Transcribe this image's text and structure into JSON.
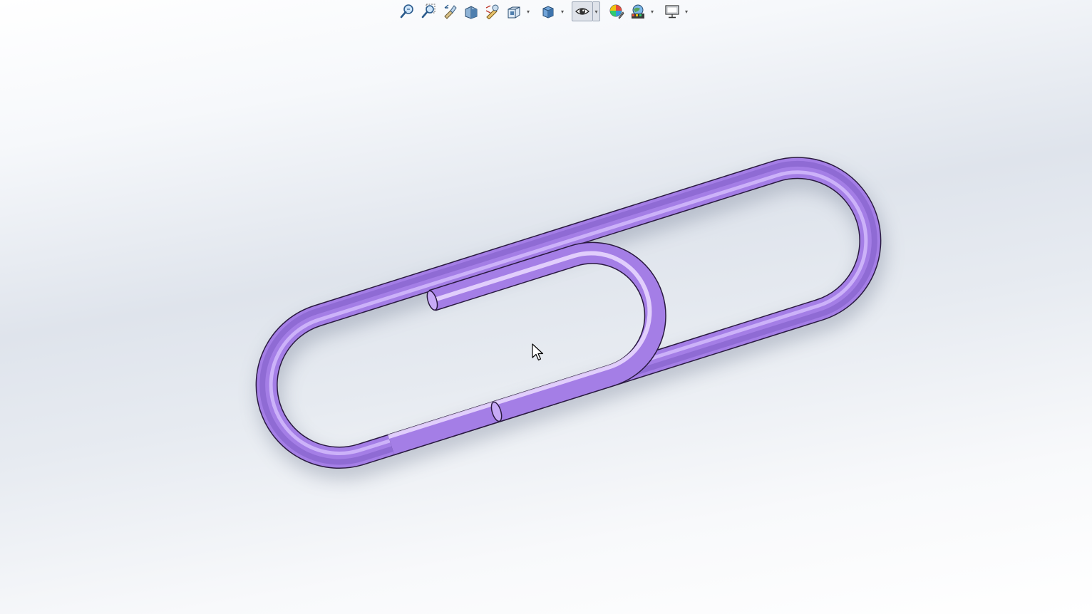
{
  "app": {
    "background_colors": [
      "#ffffff",
      "#dfe4ec",
      "#ffffff"
    ]
  },
  "toolbar": {
    "items": [
      {
        "icon": "zoom-to-fit-icon"
      },
      {
        "icon": "zoom-to-area-icon"
      },
      {
        "icon": "previous-view-icon"
      },
      {
        "icon": "section-view-icon"
      },
      {
        "icon": "dynamic-annotation-views-icon"
      },
      {
        "icon": "view-orientation-icon",
        "dropdown": true
      },
      {
        "icon": "display-style-icon",
        "dropdown": true
      },
      {
        "icon": "hide-show-items-icon",
        "dropdown": true,
        "active": true
      },
      {
        "icon": "edit-appearance-icon"
      },
      {
        "icon": "apply-scene-icon",
        "dropdown": true
      },
      {
        "icon": "view-settings-icon",
        "dropdown": true
      }
    ],
    "dropdown_glyph": "▾"
  },
  "model": {
    "name_icon": "paperclip-model",
    "color": "#a880e8",
    "highlight": "#e8d8ff",
    "shadow": "#6a4aa8",
    "edge": "#2a1a40"
  },
  "cursor": {
    "icon": "mouse-pointer-icon"
  }
}
